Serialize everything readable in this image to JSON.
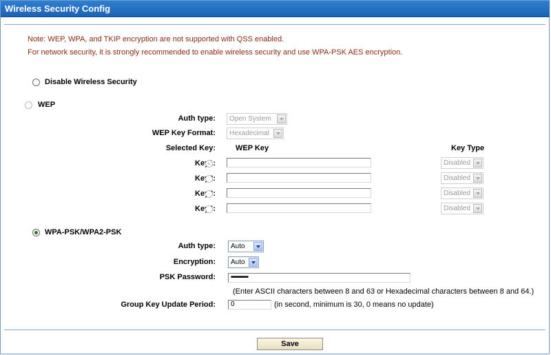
{
  "title": "Wireless Security Config",
  "notes": [
    "Note: WEP, WPA, and TKIP encryption are not supported with QSS enabled.",
    "For network security, it is strongly recommended to enable wireless security and use WPA-PSK AES encryption."
  ],
  "disable": {
    "label": "Disable Wireless Security"
  },
  "wep": {
    "label": "WEP",
    "auth_type_label": "Auth type:",
    "auth_type_value": "Open System",
    "key_format_label": "WEP Key Format:",
    "key_format_value": "Hexadecimal",
    "selected_key_label": "Selected Key:",
    "wep_key_header": "WEP Key",
    "key_type_header": "Key Type",
    "keys": [
      {
        "label": "Key1:",
        "value": "",
        "type": "Disabled",
        "selected": true
      },
      {
        "label": "Key2:",
        "value": "",
        "type": "Disabled",
        "selected": false
      },
      {
        "label": "Key3:",
        "value": "",
        "type": "Disabled",
        "selected": false
      },
      {
        "label": "Key4:",
        "value": "",
        "type": "Disabled",
        "selected": false
      }
    ]
  },
  "wpa": {
    "label": "WPA-PSK/WPA2-PSK",
    "selected": true,
    "auth_type_label": "Auth type:",
    "auth_type_value": "Auto",
    "encryption_label": "Encryption:",
    "encryption_value": "Auto",
    "psk_label": "PSK Password:",
    "psk_value": "••••••••••",
    "psk_hint": "(Enter ASCII characters between 8 and 63 or Hexadecimal characters between 8 and 64.)",
    "group_key_label": "Group Key Update Period:",
    "group_key_value": "0",
    "group_key_hint": "(in second, minimum is 30, 0 means no update)"
  },
  "save_label": "Save"
}
